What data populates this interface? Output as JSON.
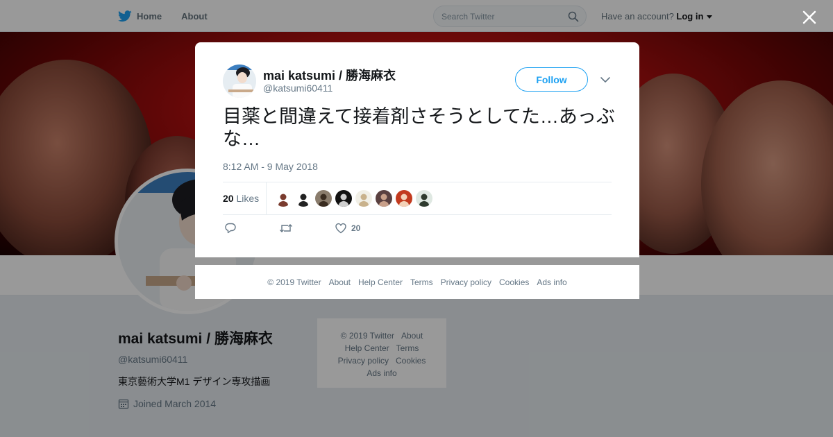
{
  "topbar": {
    "home_label": "Home",
    "about_label": "About",
    "search_placeholder": "Search Twitter",
    "account_prompt": "Have an account?",
    "login_label": "Log in"
  },
  "profile": {
    "name": "mai katsumi / 勝海麻衣",
    "handle": "@katsumi60411",
    "bio": "東京藝術大学M1 デザイン専攻描画",
    "joined": "Joined March 2014"
  },
  "side_footer": {
    "copyright": "© 2019 Twitter",
    "about": "About",
    "help": "Help Center",
    "terms": "Terms",
    "privacy": "Privacy policy",
    "cookies": "Cookies",
    "ads": "Ads info"
  },
  "tweet": {
    "author_name": "mai katsumi / 勝海麻衣",
    "author_handle": "@katsumi60411",
    "follow_label": "Follow",
    "text": "目薬と間違えて接着剤さそうとしてた…あっぶな…",
    "timestamp": "8:12 AM - 9 May 2018",
    "likes_count": "20",
    "likes_label": "Likes",
    "like_action_count": "20",
    "likers": [
      {
        "bg": "#ffffff",
        "fg": "#7a3b2e"
      },
      {
        "bg": "#ffffff",
        "fg": "#222222"
      },
      {
        "bg": "#8a7c6c",
        "fg": "#3a2c20"
      },
      {
        "bg": "#111111",
        "fg": "#cfcfcf"
      },
      {
        "bg": "#f1efe6",
        "fg": "#c9b28c"
      },
      {
        "bg": "#5a4040",
        "fg": "#c9a08a"
      },
      {
        "bg": "#c23a1e",
        "fg": "#f3d2b8"
      },
      {
        "bg": "#dfe8e2",
        "fg": "#2e3a2e"
      }
    ]
  },
  "modal_footer": {
    "copyright": "© 2019 Twitter",
    "about": "About",
    "help": "Help Center",
    "terms": "Terms",
    "privacy": "Privacy policy",
    "cookies": "Cookies",
    "ads": "Ads info"
  },
  "colors": {
    "brand_blue": "#1da1f2",
    "banner_red": "#c11212",
    "muted_text": "#657786"
  }
}
